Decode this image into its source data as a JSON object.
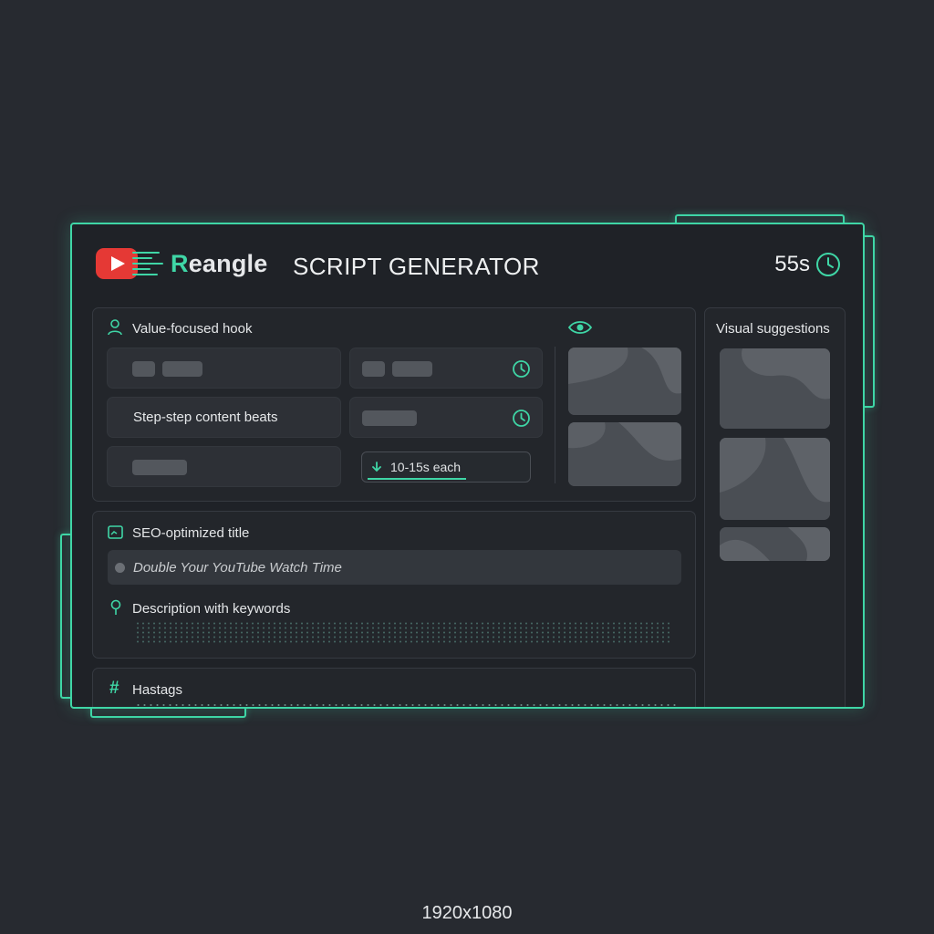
{
  "app": {
    "brand_first": "R",
    "brand_rest": "eangle",
    "title": "SCRIPT GENERATOR",
    "timer": "55s",
    "icons": {
      "logo": "youtube-play-icon",
      "timer": "clock-icon"
    }
  },
  "hook_panel": {
    "label": "Value-focused hook",
    "content_beats": "Step-step content beats",
    "duration": "10-15s each",
    "icons": {
      "label": "user-icon",
      "preview": "eye-icon",
      "clock": "clock-icon",
      "duration": "timer-down-icon"
    }
  },
  "seo_panel": {
    "title_label": "SEO-optimized title",
    "title_value": "Double Your YouTube Watch Time",
    "description_label": "Description with keywords"
  },
  "hashtags_panel": {
    "label": "Hastags"
  },
  "visual_panel": {
    "label": "Visual suggestions"
  },
  "resolution": "1920x1080",
  "colors": {
    "accent": "#3fd6a6",
    "brand_red": "#e53935",
    "background": "#272a30",
    "window": "#1f2227"
  }
}
